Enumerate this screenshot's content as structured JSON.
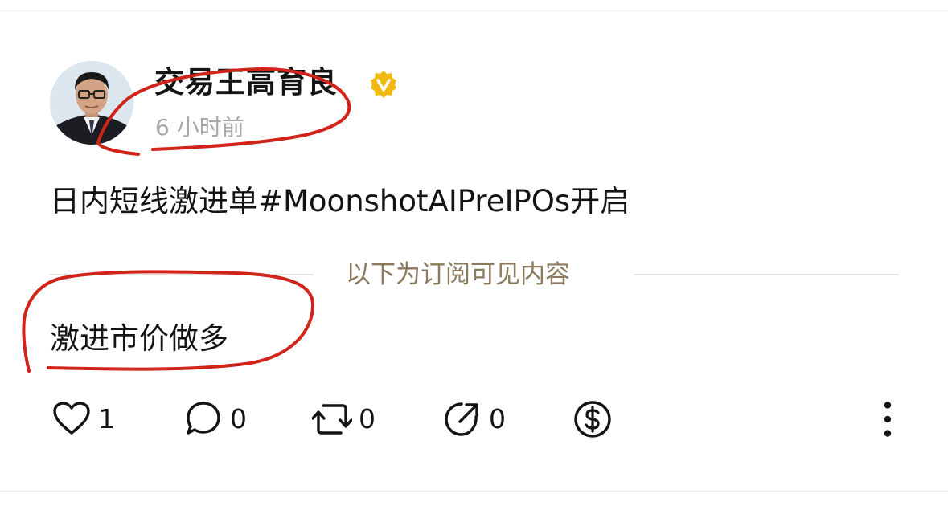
{
  "post": {
    "author": "交易王高育良",
    "verified_icon": "verified-badge-icon",
    "time": "6 小时前",
    "text": "日内短线激进单#MoonshotAIPreIPOs开启",
    "divider_label": "以下为订阅可见内容",
    "locked_text": "激进市价做多"
  },
  "actions": {
    "like_count": "1",
    "comment_count": "0",
    "repost_count": "0",
    "share_count": "0",
    "tip_icon": "dollar-coin-icon",
    "more_icon": "more-vertical-icon"
  },
  "colors": {
    "verified_badge": "#f0b90b",
    "divider_label": "#8a7a5e",
    "annotation_ink": "#d0241b",
    "time": "#a8a8a8"
  }
}
